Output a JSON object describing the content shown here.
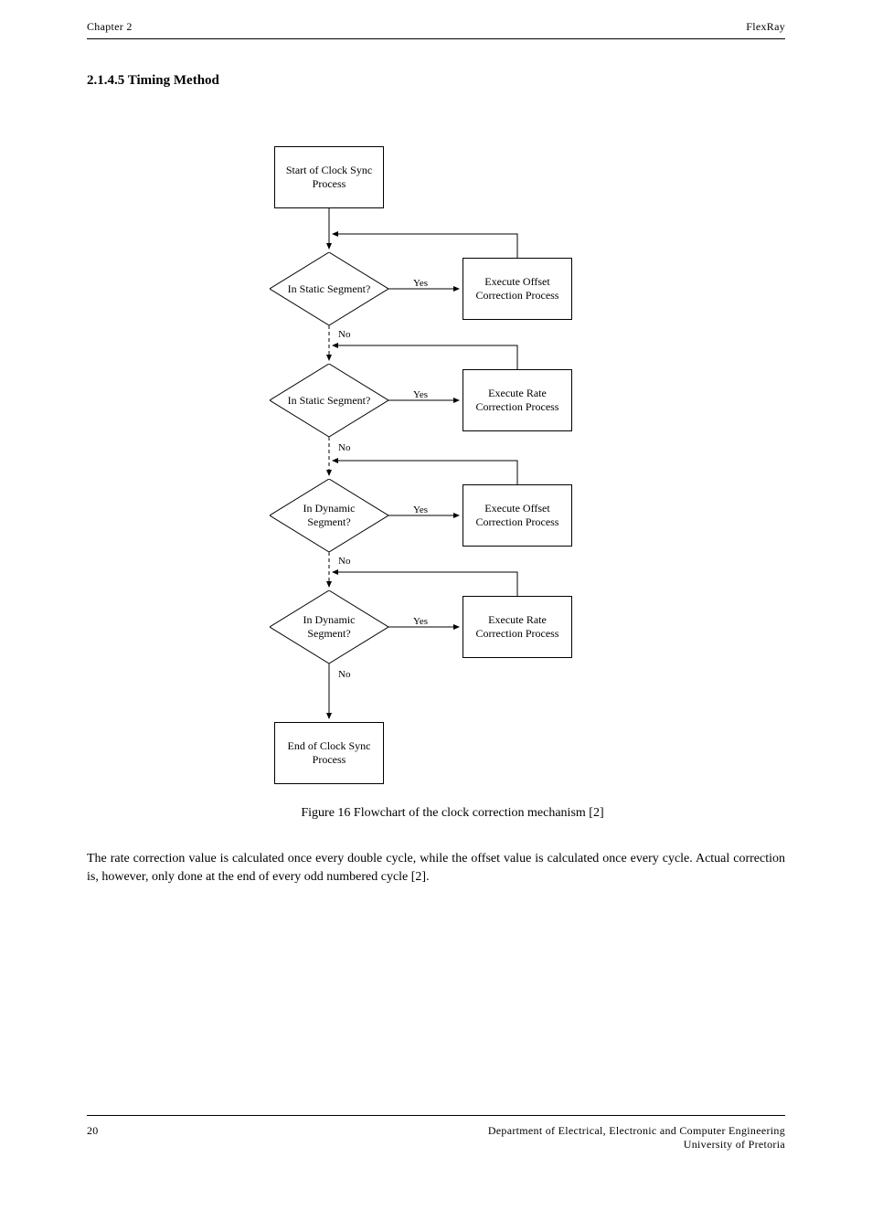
{
  "header": {
    "left": "Chapter 2",
    "right": "FlexRay"
  },
  "footer": {
    "left": "20",
    "right": "Department of Electrical, Electronic and Computer Engineering\nUniversity of Pretoria"
  },
  "figure": {
    "title": "2.1.4.5 Timing Method",
    "caption": "Figure 16 Flowchart of the clock correction mechanism [2]"
  },
  "paragraph": "The rate correction value is calculated once every double cycle, while the offset value is calculated once every cycle. Actual correction is, however, only done at the end of every odd numbered cycle [2].",
  "nodes": {
    "start": "Start of Clock\nSync Process",
    "action1": "Execute Offset\nCorrection Process",
    "action2": "Execute Rate\nCorrection Process",
    "action3": "Execute Offset\nCorrection Process",
    "action4": "Execute Rate\nCorrection Process",
    "end": "End of Clock\nSync Process",
    "dec1": "In Static\nSegment?",
    "dec2": "In Static\nSegment?",
    "dec3": "In Dynamic\nSegment?",
    "dec4": "In Dynamic\nSegment?"
  },
  "labels": {
    "yes1": "Yes",
    "no1": "No",
    "yes2": "Yes",
    "no2": "No",
    "yes3": "Yes",
    "no3": "No",
    "yes4": "Yes",
    "no4": "No"
  }
}
